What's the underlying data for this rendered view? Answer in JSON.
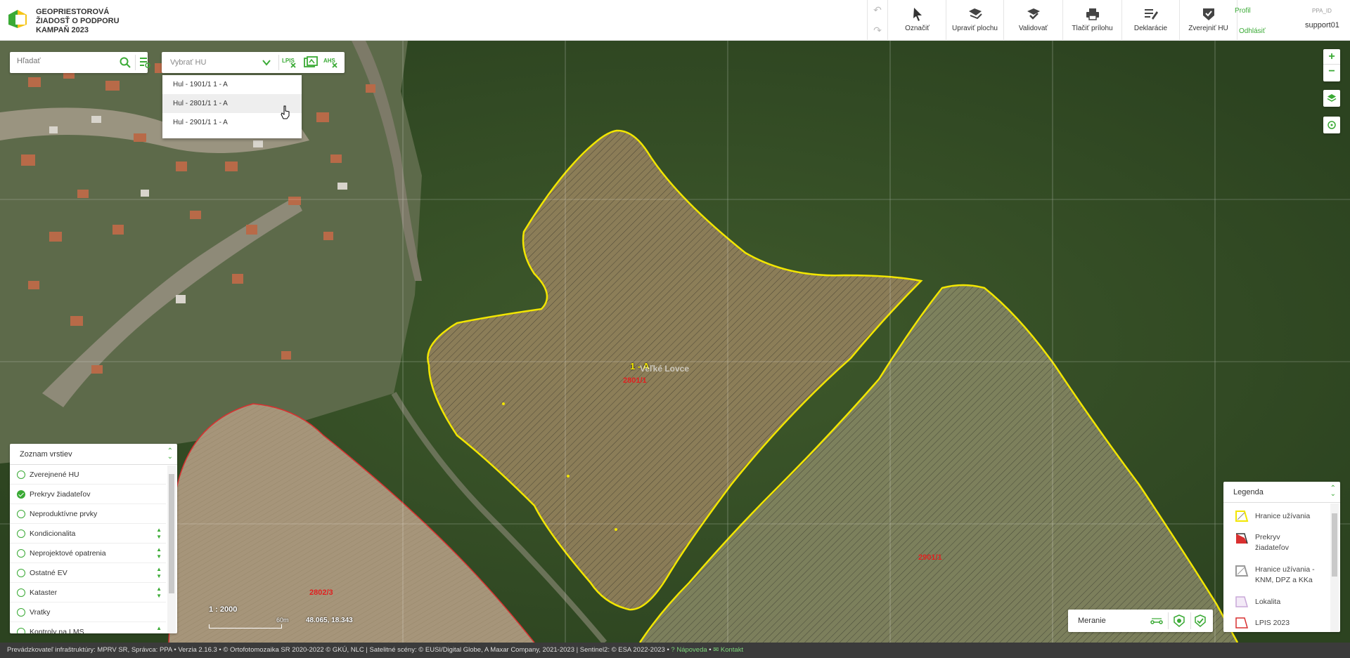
{
  "header": {
    "brand_line1": "GEOPRIESTOROVÁ",
    "brand_line2": "ŽIADOSŤ O PODPORU",
    "brand_line3": "KAMPAŇ 2023",
    "undo": "↶",
    "redo": "↷",
    "tools": [
      {
        "label": "Označiť",
        "icon": "cursor-icon"
      },
      {
        "label": "Upraviť plochu",
        "icon": "edit-area-icon"
      },
      {
        "label": "Validovať",
        "icon": "validate-icon"
      },
      {
        "label": "Tlačiť prílohu",
        "icon": "print-icon"
      },
      {
        "label": "Deklarácie",
        "icon": "declarations-icon"
      },
      {
        "label": "Zverejniť HU",
        "icon": "publish-icon"
      }
    ],
    "profile": "Profil",
    "logout": "Odhlásiť",
    "ppa_id_label": "PPA_ID",
    "username": "support01"
  },
  "search": {
    "placeholder": "Hľadať"
  },
  "hu_select": {
    "placeholder": "Vybrať HU",
    "options": [
      "Hul - 1901/1 1 - A",
      "Hul - 2801/1 1 - A",
      "Hul - 2901/1 1 - A"
    ],
    "hovered_index": 1
  },
  "map_labels": {
    "parcel_label": "1 - A",
    "place_name": "Veľké Lovce",
    "parcel_2801": "2801/1",
    "parcel_2901": "2901/1",
    "parcel_2802": "2802/3"
  },
  "map_controls": {
    "zoom_in": "+",
    "zoom_out": "−"
  },
  "layers": {
    "title": "Zoznam vrstiev",
    "items": [
      {
        "label": "Zverejnené HU",
        "checked": false,
        "expandable": false
      },
      {
        "label": "Prekryv žiadateľov",
        "checked": true,
        "expandable": false
      },
      {
        "label": "Neproduktívne prvky",
        "checked": false,
        "expandable": false
      },
      {
        "label": "Kondicionalita",
        "checked": false,
        "expandable": true
      },
      {
        "label": "Neprojektové opatrenia",
        "checked": false,
        "expandable": true
      },
      {
        "label": "Ostatné EV",
        "checked": false,
        "expandable": true
      },
      {
        "label": "Kataster",
        "checked": false,
        "expandable": true
      },
      {
        "label": "Vratky",
        "checked": false,
        "expandable": false
      },
      {
        "label": "Kontroly na LMS",
        "checked": false,
        "expandable": true
      }
    ]
  },
  "scale": {
    "ratio": "1 : 2000",
    "bar_label": "60m",
    "coords": "48.065, 18.343"
  },
  "measure": {
    "label": "Meranie"
  },
  "legend": {
    "title": "Legenda",
    "items": [
      {
        "line1": "Hranice užívania",
        "line2": ""
      },
      {
        "line1": "Prekryv",
        "line2": "žiadateľov"
      },
      {
        "line1": "Hranice užívania -",
        "line2": "KNM, DPZ a KKa"
      },
      {
        "line1": "Lokalita",
        "line2": ""
      },
      {
        "line1": "LPIS 2023",
        "line2": ""
      }
    ]
  },
  "footer": {
    "text": "Prevádzkovateľ infraštruktúry: MPRV SR, Správca: PPA • Verzia 2.16.3 • © Ortofotomozaika SR 2020-2022 © GKÚ, NLC | Satelitné scény: © EUSI/Digital Globe, A Maxar Company, 2021-2023 | Sentinel2: © ESA 2022-2023 •",
    "help": "? Nápoveda",
    "sep": "•",
    "contact": "✉ Kontakt"
  },
  "colors": {
    "accent": "#3aaa35",
    "parcel_border": "#f2e600",
    "overlap_border": "#d93030"
  }
}
